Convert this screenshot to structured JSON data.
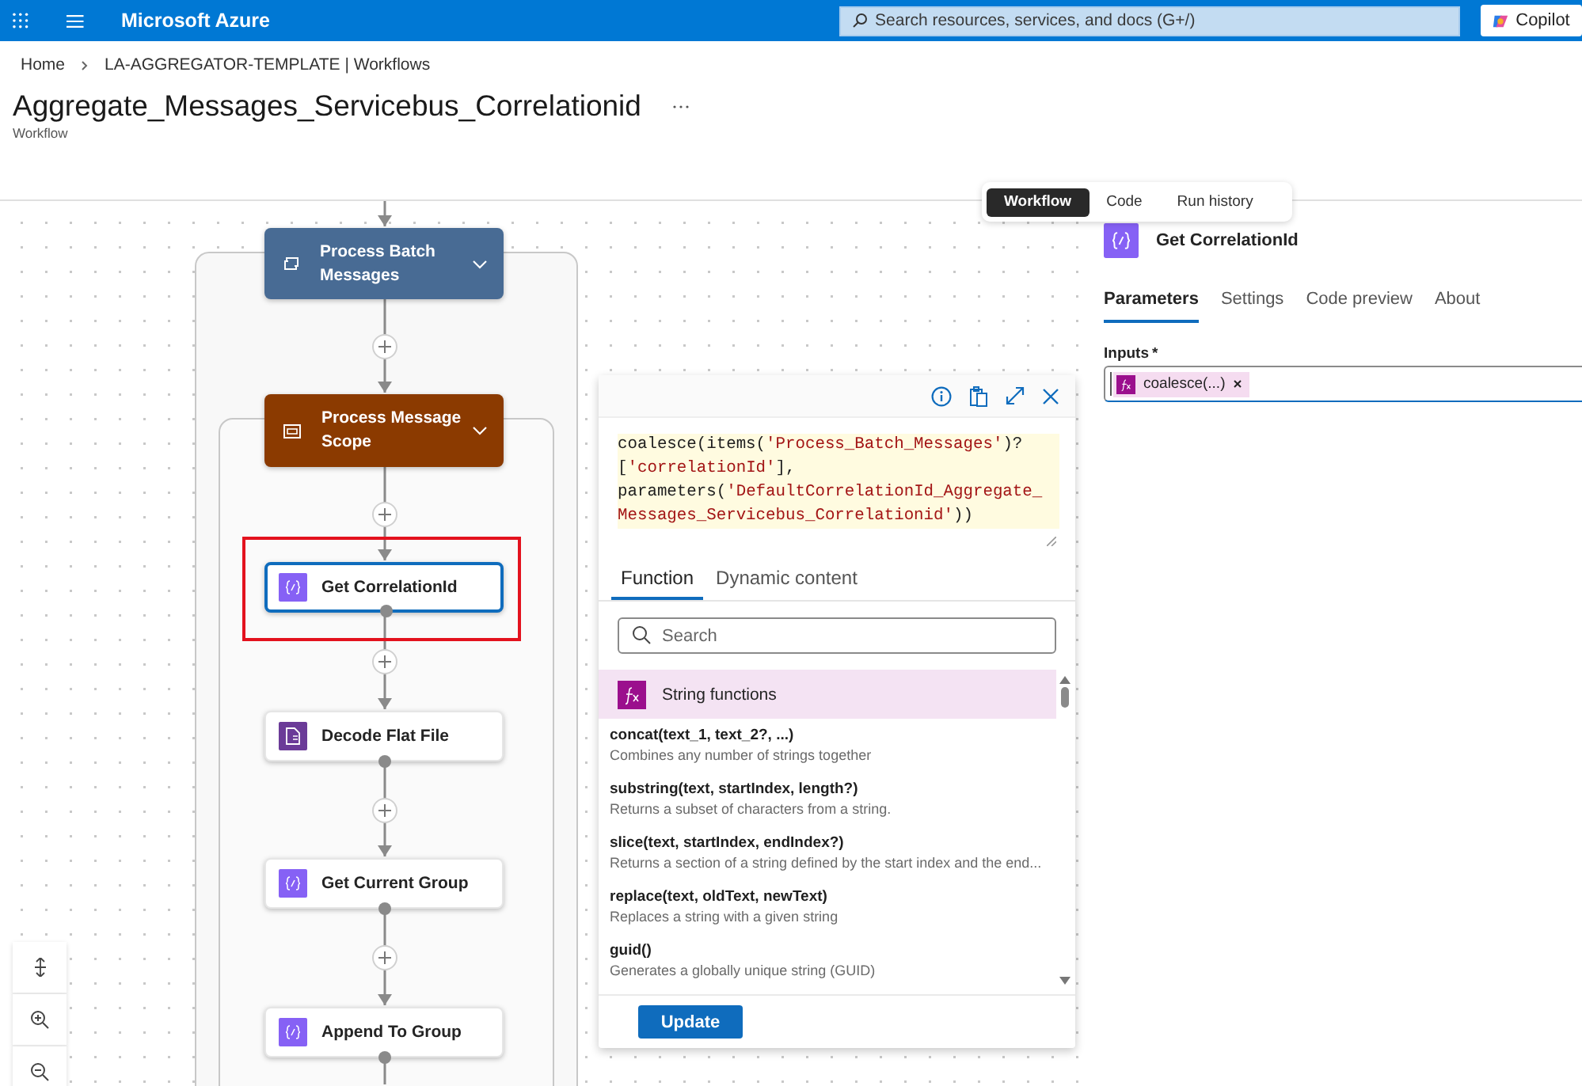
{
  "top_bar": {
    "brand": "Microsoft Azure",
    "search": {
      "placeholder": "Search resources, services, and docs (G+/)"
    },
    "copilot_button": "Copilot"
  },
  "breadcrumb": [
    {
      "label": "Home"
    },
    {
      "label": "LA-AGGREGATOR-TEMPLATE | Workflows"
    }
  ],
  "page": {
    "title": "Aggregate_Messages_Servicebus_Correlationid",
    "subtitle": "Workflow"
  },
  "view_tabs": [
    {
      "label": "Workflow",
      "selected": true
    },
    {
      "label": "Code",
      "selected": false
    },
    {
      "label": "Run history",
      "selected": false
    }
  ],
  "canvas": {
    "nodes": [
      {
        "label": "Process Batch Messages",
        "kind": "loop",
        "selected": false,
        "highlighted": false
      },
      {
        "label": "Process Message Scope",
        "kind": "scope",
        "selected": false,
        "highlighted": false
      },
      {
        "label": "Get CorrelationId",
        "kind": "compose",
        "selected": true,
        "highlighted": true
      },
      {
        "label": "Decode Flat File",
        "kind": "flatfile",
        "selected": false,
        "highlighted": false
      },
      {
        "label": "Get Current Group",
        "kind": "compose",
        "selected": false,
        "highlighted": false
      },
      {
        "label": "Append To Group",
        "kind": "compose",
        "selected": false,
        "highlighted": false
      }
    ]
  },
  "expression_editor": {
    "expression_lines": [
      [
        {
          "text": "coalesce(items(",
          "kind": "code"
        },
        {
          "text": "'Process_Batch_Messages'",
          "kind": "string"
        },
        {
          "text": ")?",
          "kind": "code"
        }
      ],
      [
        {
          "text": "[",
          "kind": "code"
        },
        {
          "text": "'correlationId'",
          "kind": "string"
        },
        {
          "text": "],",
          "kind": "code"
        }
      ],
      [
        {
          "text": "parameters(",
          "kind": "code"
        },
        {
          "text": "'DefaultCorrelationId_Aggregate_",
          "kind": "string"
        }
      ],
      [
        {
          "text": "Messages_Servicebus_Correlationid'",
          "kind": "string"
        },
        {
          "text": "))",
          "kind": "code"
        }
      ]
    ],
    "tabs": [
      {
        "label": "Function",
        "selected": true
      },
      {
        "label": "Dynamic content",
        "selected": false
      }
    ],
    "search": {
      "placeholder": "Search"
    },
    "category": "String functions",
    "functions": [
      {
        "signature": "concat(text_1, text_2?, ...)",
        "description": "Combines any number of strings together"
      },
      {
        "signature": "substring(text, startIndex, length?)",
        "description": "Returns a subset of characters from a string."
      },
      {
        "signature": "slice(text, startIndex, endIndex?)",
        "description": "Returns a section of a string defined by the start index and the end..."
      },
      {
        "signature": "replace(text, oldText, newText)",
        "description": "Replaces a string with a given string"
      },
      {
        "signature": "guid()",
        "description": "Generates a globally unique string (GUID)"
      }
    ],
    "update_button": "Update"
  },
  "details_panel": {
    "title": "Get CorrelationId",
    "tabs": [
      {
        "label": "Parameters",
        "selected": true
      },
      {
        "label": "Settings",
        "selected": false
      },
      {
        "label": "Code preview",
        "selected": false
      },
      {
        "label": "About",
        "selected": false
      }
    ],
    "inputs": {
      "label": "Inputs",
      "required_mark": "*",
      "token": "coalesce(...)"
    }
  }
}
